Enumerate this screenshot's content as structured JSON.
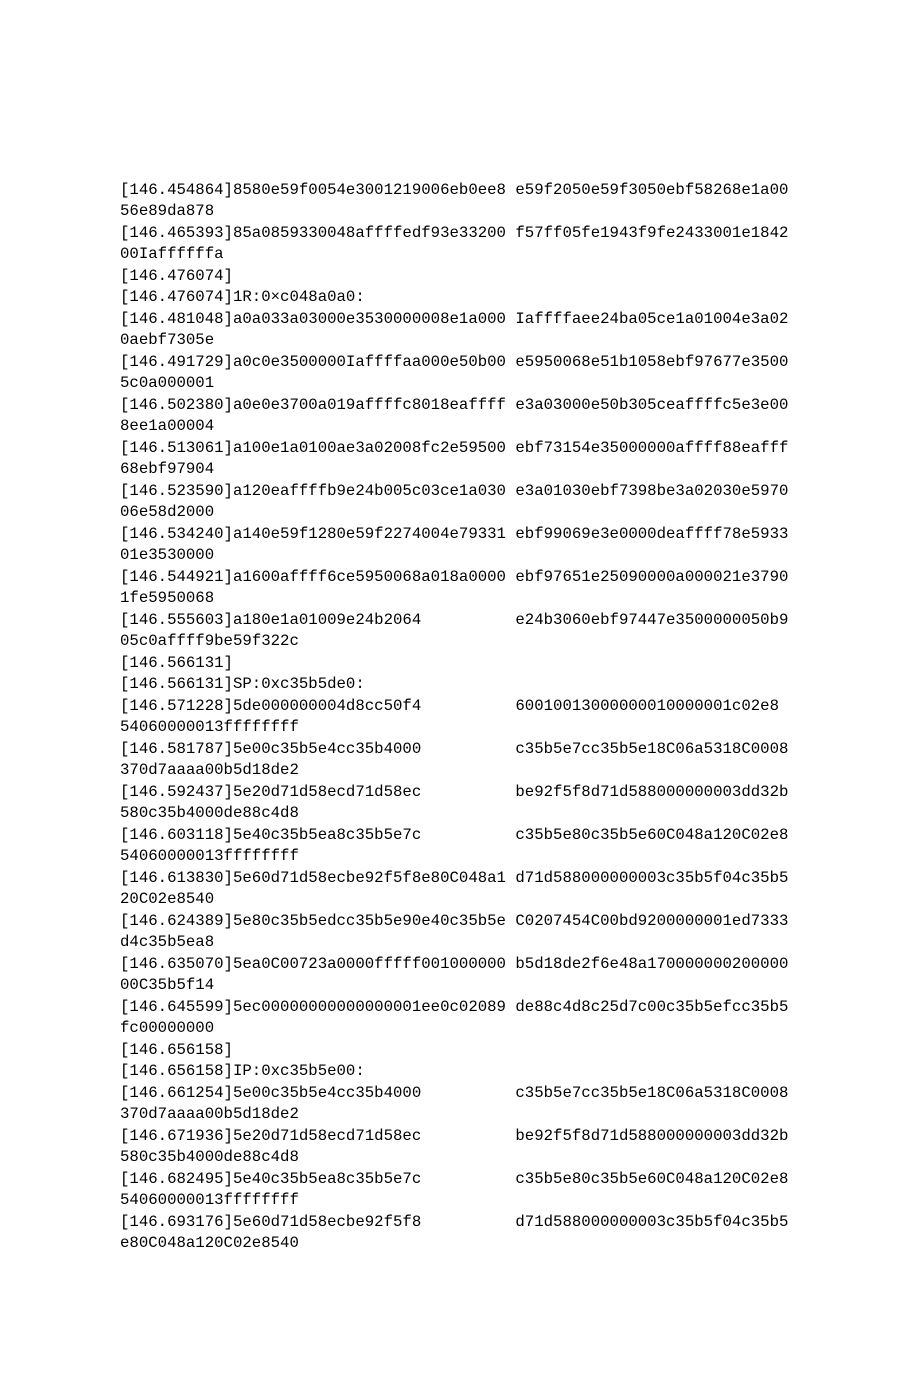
{
  "log": {
    "lines": [
      "[146.454864]8580e59f0054e3001219006eb0ee8 e59f2050e59f3050ebf58268e1a00",
      "56e89da878",
      "[146.465393]85a0859330048affffedf93e33200 f57ff05fe1943f9fe2433001e1842",
      "00Iaffffffa",
      "[146.476074]",
      "[146.476074]1R:0×c048a0a0:",
      "[146.481048]a0a033a03000e3530000008e1a000 Iaffffaee24ba05ce1a01004e3a02",
      "0aebf7305e",
      "[146.491729]a0c0e3500000Iaffffaa000e50b00 e5950068e51b1058ebf97677e3500",
      "5c0a000001",
      "[146.502380]a0e0e3700a019affffc8018eaffff e3a03000e50b305ceaffffc5e3e00",
      "8ee1a00004",
      "[146.513061]a100e1a0100ae3a02008fc2e59500 ebf73154e35000000affff88eafff",
      "68ebf97904",
      "[146.523590]a120eaffffb9e24b005c03ce1a030 e3a01030ebf7398be3a02030e5970",
      "06e58d2000",
      "[146.534240]a140e59f1280e59f2274004e79331 ebf99069e3e0000deaffff78e5933",
      "01e3530000",
      "[146.544921]a1600affff6ce5950068a018a0000 ebf97651e25090000a000021e3790",
      "1fe5950068",
      "[146.555603]a180e1a01009e24b2064          e24b3060ebf97447e3500000050b9",
      "05c0affff9be59f322c",
      "[146.566131]",
      "[146.566131]SP:0xc35b5de0:",
      "[146.571228]5de000000004d8cc50f4          60010013000000010000001c02e8",
      "54060000013ffffffff",
      "[146.581787]5e00c35b5e4cc35b4000          c35b5e7cc35b5e18C06a5318C0008",
      "370d7aaaa00b5d18de2",
      "[146.592437]5e20d71d58ecd71d58ec          be92f5f8d71d588000000003dd32b",
      "580c35b4000de88c4d8",
      "[146.603118]5e40c35b5ea8c35b5e7c          c35b5e80c35b5e60C048a120C02e8",
      "54060000013ffffffff",
      "[146.613830]5e60d71d58ecbe92f5f8e80C048a1 d71d588000000003c35b5f04c35b5",
      "20C02e8540",
      "[146.624389]5e80c35b5edcc35b5e90e40c35b5e C0207454C00bd9200000001ed7333",
      "d4c35b5ea8",
      "[146.635070]5ea0C00723a0000fffff001000000 b5d18de2f6e48a170000000200000",
      "00C35b5f14",
      "[146.645599]5ec00000000000000001ee0c02089 de88c4d8c25d7c00c35b5efcc35b5",
      "fc00000000",
      "[146.656158]",
      "[146.656158]IP:0xc35b5e00:",
      "[146.661254]5e00c35b5e4cc35b4000          c35b5e7cc35b5e18C06a5318C0008",
      "370d7aaaa00b5d18de2",
      "[146.671936]5e20d71d58ecd71d58ec          be92f5f8d71d588000000003dd32b",
      "580c35b4000de88c4d8",
      "[146.682495]5e40c35b5ea8c35b5e7c          c35b5e80c35b5e60C048a120C02e8",
      "54060000013ffffffff",
      "[146.693176]5e60d71d58ecbe92f5f8          d71d588000000003c35b5f04c35b5",
      "e80C048a120C02e8540"
    ]
  }
}
